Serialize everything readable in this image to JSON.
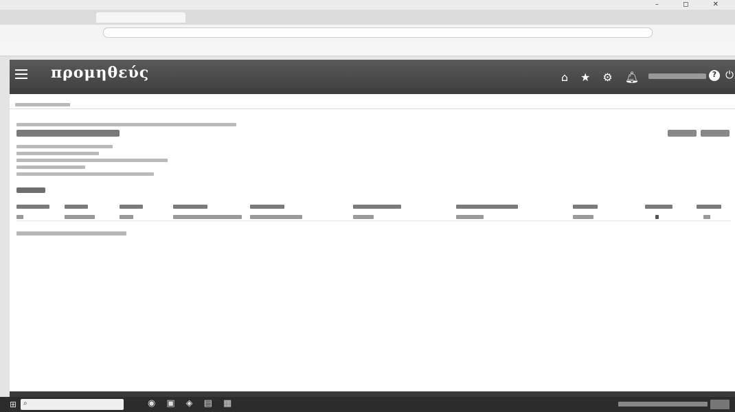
{
  "window": {
    "controls": "– ◻ ✕"
  },
  "tabs": [
    {
      "label": ""
    },
    {
      "label": ""
    }
  ],
  "app": {
    "logo_text": "προμηθεύς"
  },
  "header_icons": [
    "home-icon",
    "star-icon",
    "gear-icon",
    "bell-icon"
  ],
  "taskbar": {
    "start_glyph": "⊞",
    "search_glyph": "⌕"
  }
}
